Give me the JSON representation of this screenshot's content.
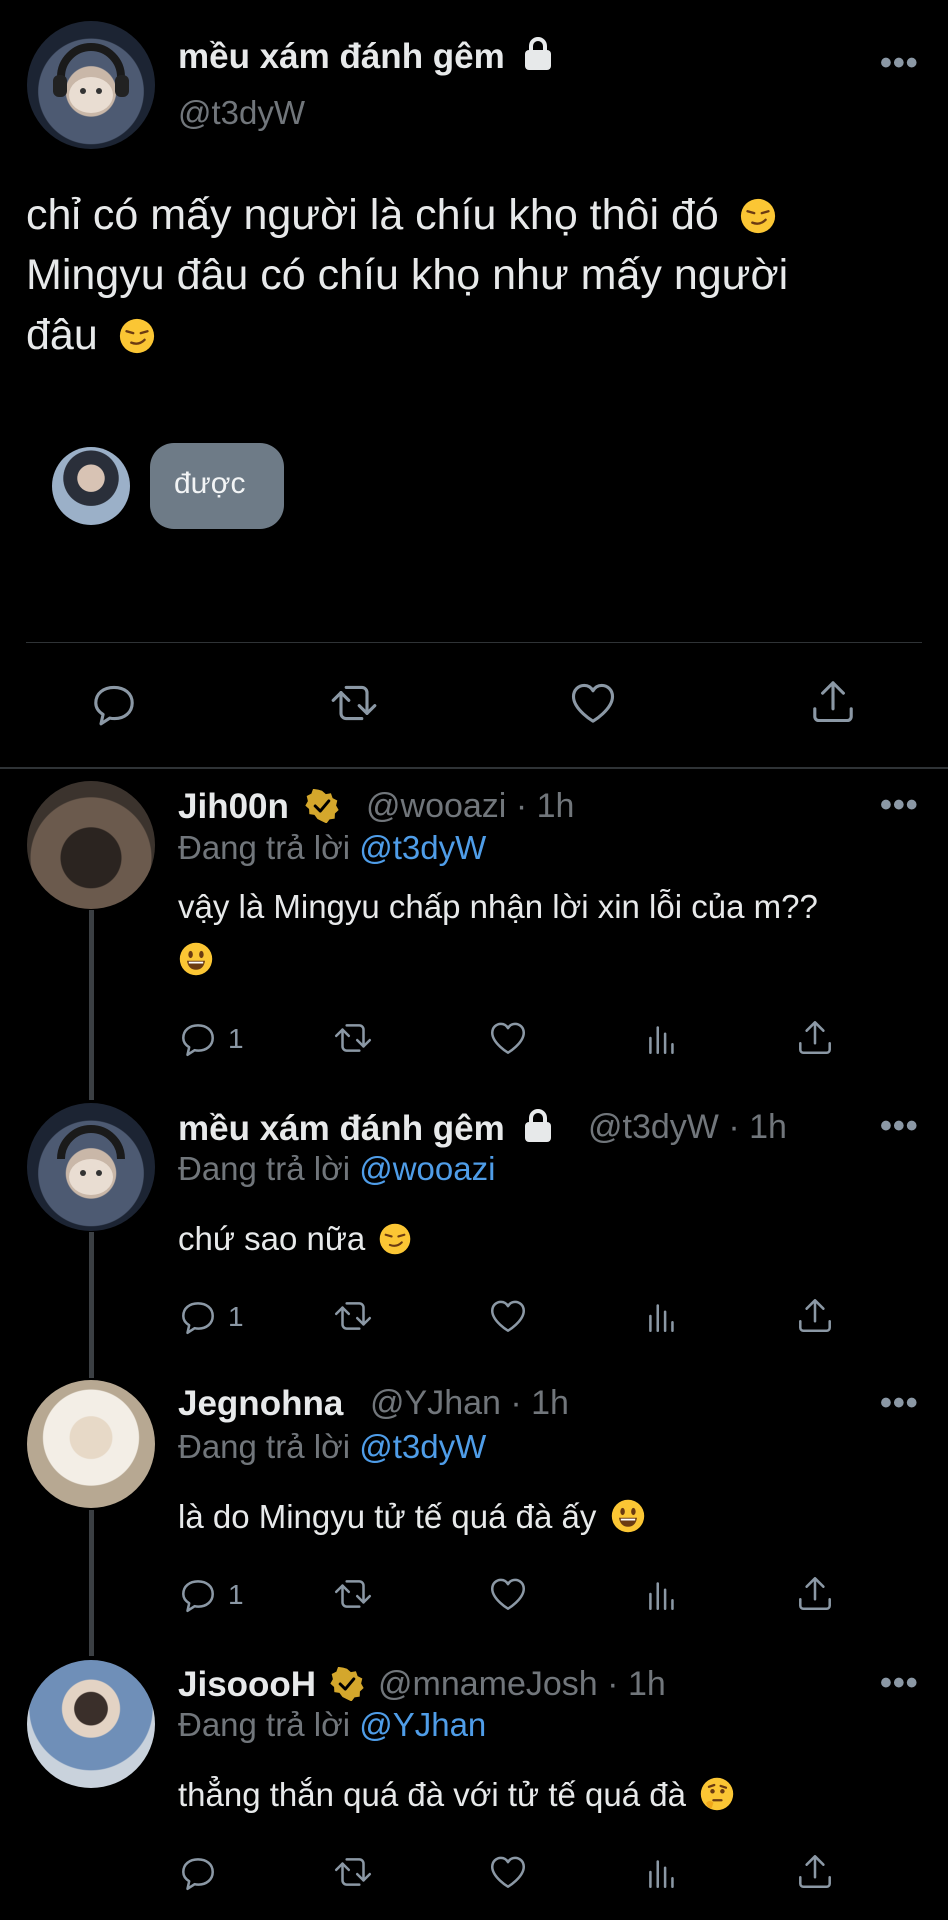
{
  "main_tweet": {
    "display_name": "mều xám đánh gêm",
    "handle": "@t3dyW",
    "text_line1": "chỉ có mấy người là chíu khọ thôi đó",
    "text_line2": "Mingyu đâu có chíu khọ như mấy người",
    "text_line3": "đâu",
    "quoted_bubble": "được"
  },
  "replies": [
    {
      "name": "Jih00n",
      "verified": true,
      "handle": "@wooazi",
      "time": "· 1h",
      "replying_label": "Đang trả lời",
      "replying_to": "@t3dyW",
      "text_line1": "vậy là Mingyu chấp nhận lời xin lỗi của m??",
      "reply_count": "1"
    },
    {
      "name": "mều xám đánh gêm",
      "locked": true,
      "handle": "@t3dyW",
      "time": "· 1h",
      "replying_label": "Đang trả lời",
      "replying_to": "@wooazi",
      "text_line1": "chứ sao nữa",
      "reply_count": "1"
    },
    {
      "name": "Jegnohna",
      "handle": "@YJhan",
      "time": "· 1h",
      "replying_label": "Đang trả lời",
      "replying_to": "@t3dyW",
      "text_line1": "là do Mingyu tử tế quá đà ấy",
      "reply_count": "1"
    },
    {
      "name": "JisoooH",
      "verified": true,
      "handle": "@mnameJosh",
      "time": "· 1h",
      "replying_label": "Đang trả lời",
      "replying_to": "@YJhan",
      "text_line1": "thẳng thắn quá đà với tử tế quá đà",
      "reply_count": ""
    }
  ],
  "icons": {
    "more": "more-dots-icon",
    "lock": "lock-icon",
    "verified": "verified-badge-icon",
    "reply": "reply-icon",
    "retweet": "retweet-icon",
    "like": "heart-icon",
    "views": "views-icon",
    "share": "share-icon"
  },
  "colors": {
    "background": "#000000",
    "text": "#e7e9ea",
    "secondary": "#71767b",
    "link": "#4f9de8",
    "verified": "#d4a72c",
    "bubble": "#6e7b87"
  },
  "more_glyph": "•••"
}
